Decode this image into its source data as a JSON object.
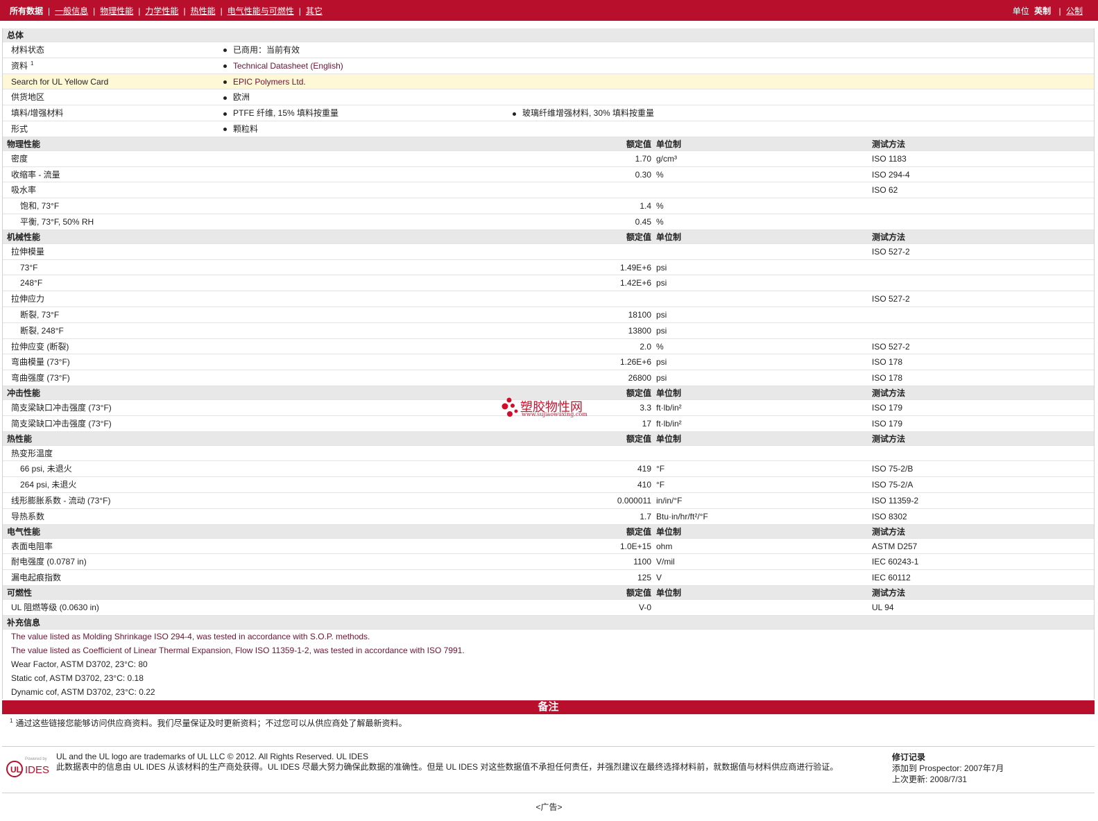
{
  "topbar": {
    "tabs": [
      "所有数据",
      "一般信息",
      "物理性能",
      "力学性能",
      "热性能",
      "电气性能与可燃性",
      "其它"
    ],
    "units_label": "单位",
    "unit_current": "英制",
    "unit_other": "公制"
  },
  "general": {
    "title": "总体",
    "rows": [
      {
        "name": "材料状态",
        "v1": "已商用：当前有效",
        "v2": ""
      },
      {
        "name": "资料",
        "sup": "1",
        "v1": "Technical Datasheet (English)",
        "v2": ""
      },
      {
        "name": "Search for UL Yellow Card",
        "v1": "EPIC Polymers Ltd.",
        "v2": ""
      },
      {
        "name": "供货地区",
        "v1": "欧洲",
        "v2": ""
      },
      {
        "name": "填料/增强材料",
        "v1": "PTFE 纤维, 15% 填料按重量",
        "v2": "玻璃纤维增强材料, 30% 填料按重量"
      },
      {
        "name": "形式",
        "v1": "颗粒料",
        "v2": ""
      }
    ]
  },
  "col_headers": {
    "value": "额定值",
    "unit": "单位制",
    "test": "测试方法"
  },
  "sections": [
    {
      "title": "物理性能",
      "rows": [
        {
          "name": "密度",
          "ind": false,
          "value": "1.70",
          "unit": "g/cm³",
          "test": "ISO 1183"
        },
        {
          "name": "收缩率 - 流量",
          "ind": false,
          "value": "0.30",
          "unit": "%",
          "test": "ISO 294-4"
        },
        {
          "name": "吸水率",
          "ind": false,
          "value": "",
          "unit": "",
          "test": "ISO 62"
        },
        {
          "name": "饱和, 73°F",
          "ind": true,
          "value": "1.4",
          "unit": "%",
          "test": ""
        },
        {
          "name": "平衡, 73°F, 50% RH",
          "ind": true,
          "value": "0.45",
          "unit": "%",
          "test": ""
        }
      ]
    },
    {
      "title": "机械性能",
      "rows": [
        {
          "name": "拉伸模量",
          "ind": false,
          "value": "",
          "unit": "",
          "test": "ISO 527-2"
        },
        {
          "name": "73°F",
          "ind": true,
          "value": "1.49E+6",
          "unit": "psi",
          "test": ""
        },
        {
          "name": "248°F",
          "ind": true,
          "value": "1.42E+6",
          "unit": "psi",
          "test": ""
        },
        {
          "name": "拉伸应力",
          "ind": false,
          "value": "",
          "unit": "",
          "test": "ISO 527-2"
        },
        {
          "name": "断裂, 73°F",
          "ind": true,
          "value": "18100",
          "unit": "psi",
          "test": ""
        },
        {
          "name": "断裂, 248°F",
          "ind": true,
          "value": "13800",
          "unit": "psi",
          "test": ""
        },
        {
          "name": "拉伸应变 (断裂)",
          "ind": false,
          "value": "2.0",
          "unit": "%",
          "test": "ISO 527-2"
        },
        {
          "name": "弯曲模量 (73°F)",
          "ind": false,
          "value": "1.26E+6",
          "unit": "psi",
          "test": "ISO 178"
        },
        {
          "name": "弯曲强度 (73°F)",
          "ind": false,
          "value": "26800",
          "unit": "psi",
          "test": "ISO 178"
        }
      ]
    },
    {
      "title": "冲击性能",
      "rows": [
        {
          "name": "简支梁缺口冲击强度 (73°F)",
          "ind": false,
          "value": "3.3",
          "unit": "ft·lb/in²",
          "test": "ISO 179"
        },
        {
          "name": "简支梁缺口冲击强度 (73°F)",
          "ind": false,
          "value": "17",
          "unit": "ft·lb/in²",
          "test": "ISO 179"
        }
      ]
    },
    {
      "title": "热性能",
      "rows": [
        {
          "name": "热变形温度",
          "ind": false,
          "value": "",
          "unit": "",
          "test": ""
        },
        {
          "name": "66 psi, 未退火",
          "ind": true,
          "value": "419",
          "unit": "°F",
          "test": "ISO 75-2/B"
        },
        {
          "name": "264 psi, 未退火",
          "ind": true,
          "value": "410",
          "unit": "°F",
          "test": "ISO 75-2/A"
        },
        {
          "name": "线形膨胀系数 - 流动 (73°F)",
          "ind": false,
          "value": "0.000011",
          "unit": "in/in/°F",
          "test": "ISO 11359-2"
        },
        {
          "name": "导热系数",
          "ind": false,
          "value": "1.7",
          "unit": "Btu·in/hr/ft²/°F",
          "test": "ISO 8302"
        }
      ]
    },
    {
      "title": "电气性能",
      "rows": [
        {
          "name": "表面电阻率",
          "ind": false,
          "value": "1.0E+15",
          "unit": "ohm",
          "test": "ASTM D257"
        },
        {
          "name": "耐电强度 (0.0787 in)",
          "ind": false,
          "value": "1100",
          "unit": "V/mil",
          "test": "IEC 60243-1"
        },
        {
          "name": "漏电起痕指数",
          "ind": false,
          "value": "125",
          "unit": "V",
          "test": "IEC 60112"
        }
      ]
    },
    {
      "title": "可燃性",
      "rows": [
        {
          "name": "UL 阻燃等级 (0.0630 in)",
          "ind": false,
          "value": "V-0",
          "unit": "",
          "test": "UL 94"
        }
      ]
    }
  ],
  "supplement": {
    "title": "补充信息",
    "lines": [
      {
        "text": "The value listed as Molding Shrinkage ISO 294-4, was tested in accordance with S.O.P. methods.",
        "maroon": true
      },
      {
        "text": "The value listed as Coefficient of Linear Thermal Expansion, Flow ISO 11359-1-2, was tested in accordance with ISO 7991.",
        "maroon": true
      },
      {
        "text": "Wear Factor, ASTM D3702, 23°C: 80",
        "maroon": false
      },
      {
        "text": "Static cof, ASTM D3702, 23°C: 0.18",
        "maroon": false
      },
      {
        "text": "Dynamic cof, ASTM D3702, 23°C: 0.22",
        "maroon": false
      }
    ]
  },
  "notes_bar": "备注",
  "footnote": {
    "sup": "1",
    "text": "通过这些链接您能够访问供应商资料。我们尽量保证及时更新资料；不过您可以从供应商处了解最新资料。"
  },
  "footer": {
    "logo_powered": "Powered by",
    "logo_text": "IDES",
    "line1": "UL and the UL logo are trademarks of UL LLC © 2012. All Rights Reserved. UL IDES",
    "line2": "此数据表中的信息由 UL IDES 从该材料的生产商处获得。UL IDES 尽最大努力确保此数据的准确性。但是 UL IDES 对这些数据值不承担任何责任，并强烈建议在最终选择材料前，就数据值与材料供应商进行验证。",
    "rev_title": "修订记录",
    "rev_added": "添加到 Prospector: 2007年7月",
    "rev_updated": "上次更新: 2008/7/31"
  },
  "watermark": {
    "text": "塑胶物性网",
    "url": "www.sujiaowuxing.com"
  },
  "ad_label": "<广告>",
  "colors": {
    "brand_red": "#b8102c",
    "link_maroon": "#6d1233",
    "header_gray": "#e8e8e8",
    "highlight": "#fff8d6"
  }
}
